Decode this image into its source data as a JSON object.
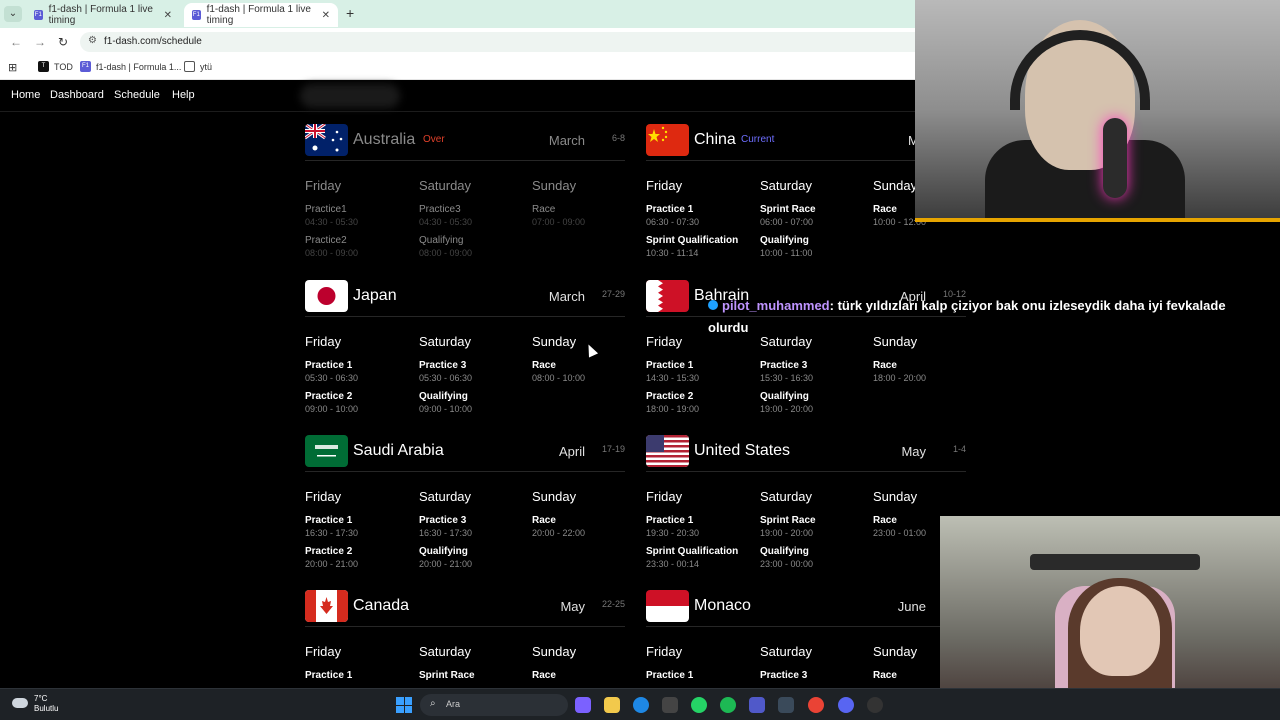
{
  "browser": {
    "tabs": [
      {
        "label": "f1-dash | Formula 1 live timing",
        "active": false
      },
      {
        "label": "f1-dash | Formula 1 live timing",
        "active": true
      }
    ],
    "url": "f1-dash.com/schedule",
    "bookmarks": [
      "TOD",
      "f1-dash | Formula 1...",
      "ytü"
    ]
  },
  "site_nav": [
    "Home",
    "Dashboard",
    "Schedule",
    "Help"
  ],
  "races": [
    {
      "country": "Australia",
      "status": "Over",
      "month": "March",
      "days": "6-8",
      "flag": "australia",
      "sessions": [
        [
          {
            "name": "Practice1",
            "time": "04:30 - 05:30"
          },
          {
            "name": "Practice2",
            "time": "08:00 - 09:00"
          }
        ],
        [
          {
            "name": "Practice3",
            "time": "04:30 - 05:30"
          },
          {
            "name": "Qualifying",
            "time": "08:00 - 09:00"
          }
        ],
        [
          {
            "name": "Race",
            "time": "07:00 - 09:00"
          }
        ]
      ]
    },
    {
      "country": "China",
      "status": "Current",
      "month": "Ma",
      "days": "",
      "flag": "china",
      "sessions": [
        [
          {
            "name": "Practice 1",
            "time": "06:30 - 07:30"
          },
          {
            "name": "Sprint Qualification",
            "time": "10:30 - 11:14"
          }
        ],
        [
          {
            "name": "Sprint Race",
            "time": "06:00 - 07:00"
          },
          {
            "name": "Qualifying",
            "time": "10:00 - 11:00"
          }
        ],
        [
          {
            "name": "Race",
            "time": "10:00 - 12:00"
          }
        ]
      ]
    },
    {
      "country": "Japan",
      "status": "",
      "month": "March",
      "days": "27-29",
      "flag": "japan",
      "sessions": [
        [
          {
            "name": "Practice 1",
            "time": "05:30 - 06:30"
          },
          {
            "name": "Practice 2",
            "time": "09:00 - 10:00"
          }
        ],
        [
          {
            "name": "Practice 3",
            "time": "05:30 - 06:30"
          },
          {
            "name": "Qualifying",
            "time": "09:00 - 10:00"
          }
        ],
        [
          {
            "name": "Race",
            "time": "08:00 - 10:00"
          }
        ]
      ]
    },
    {
      "country": "Bahrain",
      "status": "",
      "month": "April",
      "days": "10-12",
      "flag": "bahrain",
      "sessions": [
        [
          {
            "name": "Practice 1",
            "time": "14:30 - 15:30"
          },
          {
            "name": "Practice 2",
            "time": "18:00 - 19:00"
          }
        ],
        [
          {
            "name": "Practice 3",
            "time": "15:30 - 16:30"
          },
          {
            "name": "Qualifying",
            "time": "19:00 - 20:00"
          }
        ],
        [
          {
            "name": "Race",
            "time": "18:00 - 20:00"
          }
        ]
      ]
    },
    {
      "country": "Saudi Arabia",
      "status": "",
      "month": "April",
      "days": "17-19",
      "flag": "saudi",
      "sessions": [
        [
          {
            "name": "Practice 1",
            "time": "16:30 - 17:30"
          },
          {
            "name": "Practice 2",
            "time": "20:00 - 21:00"
          }
        ],
        [
          {
            "name": "Practice 3",
            "time": "16:30 - 17:30"
          },
          {
            "name": "Qualifying",
            "time": "20:00 - 21:00"
          }
        ],
        [
          {
            "name": "Race",
            "time": "20:00 - 22:00"
          }
        ]
      ]
    },
    {
      "country": "United States",
      "status": "",
      "month": "May",
      "days": "1-4",
      "flag": "usa",
      "sessions": [
        [
          {
            "name": "Practice 1",
            "time": "19:30 - 20:30"
          },
          {
            "name": "Sprint Qualification",
            "time": "23:30 - 00:14"
          }
        ],
        [
          {
            "name": "Sprint Race",
            "time": "19:00 - 20:00"
          },
          {
            "name": "Qualifying",
            "time": "23:00 - 00:00"
          }
        ],
        [
          {
            "name": "Race",
            "time": "23:00 - 01:00"
          }
        ]
      ]
    },
    {
      "country": "Canada",
      "status": "",
      "month": "May",
      "days": "22-25",
      "flag": "canada",
      "sessions": [
        [
          {
            "name": "Practice 1",
            "time": ""
          }
        ],
        [
          {
            "name": "Sprint Race",
            "time": ""
          }
        ],
        [
          {
            "name": "Race",
            "time": ""
          }
        ]
      ]
    },
    {
      "country": "Monaco",
      "status": "",
      "month": "June",
      "days": "",
      "flag": "monaco",
      "sessions": [
        [
          {
            "name": "Practice 1",
            "time": ""
          }
        ],
        [
          {
            "name": "Practice 3",
            "time": ""
          }
        ],
        [
          {
            "name": "Race",
            "time": ""
          }
        ]
      ]
    }
  ],
  "day_names": [
    "Friday",
    "Saturday",
    "Sunday"
  ],
  "chat": {
    "user": "pilot_muhammed",
    "message": ": türk yıldızları kalp çiziyor bak onu izleseydik daha iyi fevkalade olurdu"
  },
  "taskbar": {
    "temp": "7°C",
    "weather": "Bulutlu",
    "search_placeholder": "Ara"
  },
  "colors": {
    "over": "#e0402a",
    "current": "#6e6eff"
  }
}
